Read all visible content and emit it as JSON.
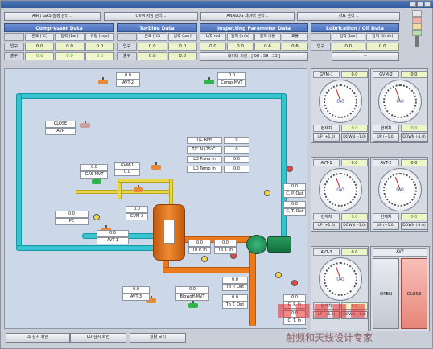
{
  "window": {
    "title": ""
  },
  "nav": [
    "AIR / GAS 설정 관리 ..",
    "OVM 저장 관리 ..",
    "ANALOG 데이터 관리 ..",
    "자료 관리 .."
  ],
  "compressor": {
    "title": "Compressor Data",
    "cols": [
      "온도 (℃)",
      "압력 (bar)",
      "유량 (m/s)"
    ],
    "rows": [
      {
        "label": "입구",
        "values": [
          "0.0",
          "0.0",
          "0.0"
        ]
      },
      {
        "label": "출구",
        "values": [
          "0.0",
          "0.0",
          "0.0"
        ]
      }
    ]
  },
  "turbine": {
    "title": "Turbine Data",
    "cols": [
      "온도 (℃)",
      "압력 (bar)"
    ],
    "rows": [
      {
        "label": "입구",
        "values": [
          "0.0",
          "0.0"
        ]
      },
      {
        "label": "출구",
        "values": [
          "0.0",
          "0.0"
        ]
      }
    ]
  },
  "inspecting": {
    "title": "Inspecting Parameter Data",
    "cols": [
      "U/C red",
      "압력 (m/s)",
      "압력 비율",
      "효율"
    ],
    "values": [
      "0.0",
      "0.0",
      "0.6",
      "0.6"
    ],
    "save_label": "데이터 저장 : [ 08 : 59 : 33 ]"
  },
  "lubrication": {
    "title": "Lubrication / Oil Data",
    "cols": [
      "압력 (bar)",
      "압력 (l/min)"
    ],
    "rows": [
      {
        "label": "입구",
        "values": [
          "0.0",
          "0.0"
        ]
      }
    ],
    "extra": "--"
  },
  "diagram": {
    "avt2": {
      "value": "0.0",
      "label": "AVT-2"
    },
    "compmvt": {
      "value": "0.0",
      "label": "Comp-MVT"
    },
    "avp": {
      "state": "CLOSE",
      "label": "AVP"
    },
    "gvm1": {
      "value": "0.0",
      "label": "GVM-1"
    },
    "gasmvt": {
      "value": "0.0",
      "label": "GAS-MVT"
    },
    "gvm2": {
      "value": "0.0",
      "label": "GVM-2"
    },
    "pe": {
      "value": "0.0",
      "label": "PE"
    },
    "avt1": {
      "value": "0.0",
      "label": "AVT-1"
    },
    "avt3": {
      "value": "0.0",
      "label": "AVT-3"
    },
    "blowoff": {
      "value": "0.0",
      "label": "Blowoff-MVT"
    },
    "tc_rpm": {
      "label": "T/C RPM",
      "value": "0"
    },
    "tcn": {
      "label": "T/C N (25℃)",
      "value": "0"
    },
    "lo_press": {
      "label": "LO Press In",
      "value": "0.0"
    },
    "lo_temp": {
      "label": "LO Temp In",
      "value": "0.0"
    },
    "cpout": {
      "value": "0.0",
      "label": "C. P. Out"
    },
    "ctout": {
      "value": "0.0",
      "label": "C. T. Out"
    },
    "tbpin": {
      "value": "0.0",
      "label": "Tb P. In"
    },
    "tbtin": {
      "value": "0.0",
      "label": "Tb T. In"
    },
    "tbpout": {
      "value": "0.0",
      "label": "Tb P. Out"
    },
    "tbtout": {
      "value": "0.0",
      "label": "Tb T. Out"
    },
    "cpin": {
      "value": "0.0",
      "label": "C. P. In"
    },
    "ctin": {
      "value": "0.0",
      "label": "C. T. In"
    }
  },
  "gauges": [
    {
      "name": "GVM-1",
      "value": "0.0",
      "dial": "0.0",
      "current_label": "현재치",
      "current": "0.0",
      "up": "UP (+1.0)",
      "down": "DOWN (-1.0)"
    },
    {
      "name": "GVM-2",
      "value": "0.0",
      "dial": "0.0",
      "current_label": "현재치",
      "current": "0.0",
      "up": "UP (+1.0)",
      "down": "DOWN (-1.0)"
    },
    {
      "name": "AVT-1",
      "value": "0.0",
      "dial": "0.0",
      "current_label": "현재치",
      "current": "0.0",
      "up": "UP (+1.0)",
      "down": "DOWN (-1.0)"
    },
    {
      "name": "AVT-2",
      "value": "0.0",
      "dial": "0.0",
      "current_label": "현재치",
      "current": "0.0",
      "up": "UP (+1.0)",
      "down": "DOWN (-1.0)"
    },
    {
      "name": "AVT-3",
      "value": "0.0",
      "dial": "0.0",
      "current_label": "현재치",
      "current": "0.0",
      "up": "UP (+1.0)",
      "down": "DOWN (-1.0)"
    }
  ],
  "avp_panel": {
    "title": "AVP",
    "open": "OPEN",
    "close": "CLOSE"
  },
  "bottom": [
    "조 감시 화면",
    "LO 감시 화면",
    "알람 보기"
  ],
  "watermark": "射频和天线设计专家",
  "colors": {
    "pipe_blue": "#37c4cf",
    "pipe_orange": "#ea7a1b",
    "pipe_yellow": "#e6d84a",
    "header_blue": "#4a6fbf",
    "valve_green": "#2fb34a",
    "valve_orange": "#e88a3a"
  }
}
